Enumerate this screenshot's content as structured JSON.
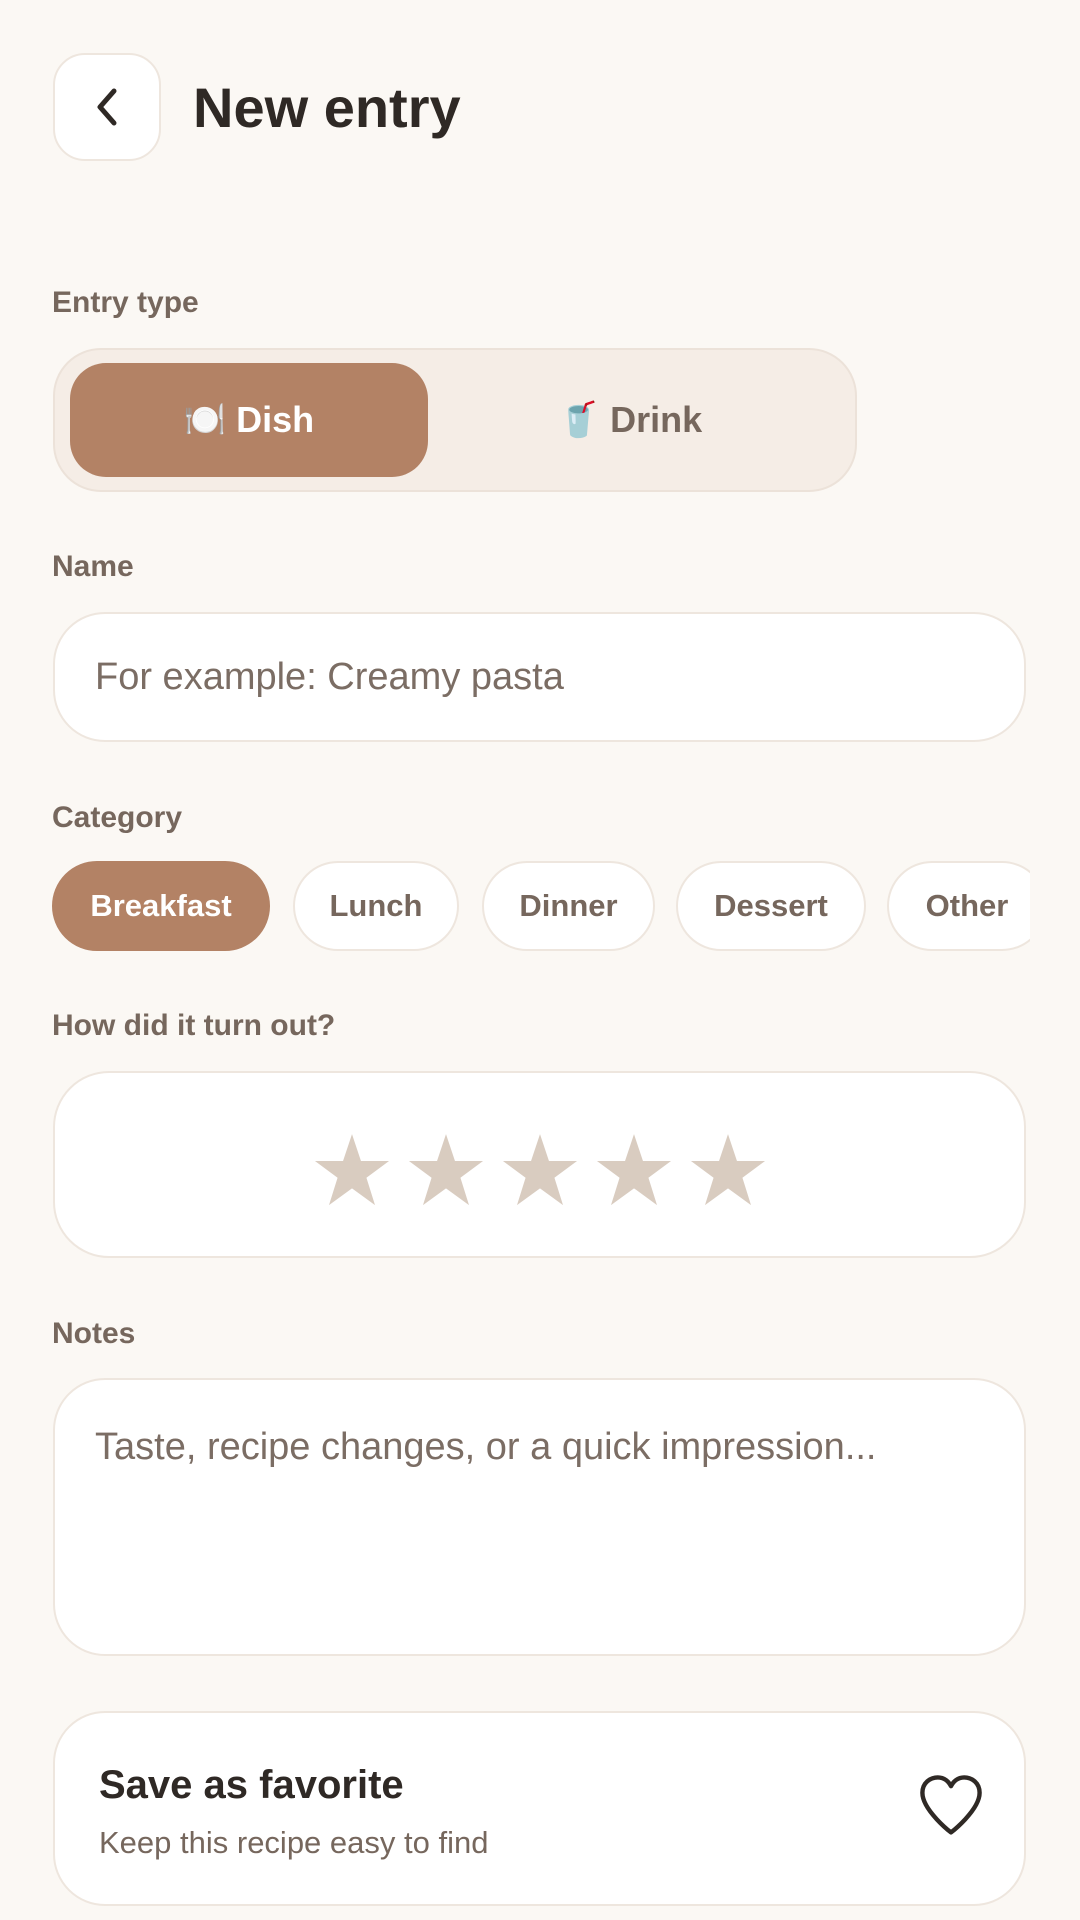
{
  "header": {
    "title": "New entry"
  },
  "entry_type": {
    "label": "Entry type",
    "options": [
      {
        "emoji": "🍽️",
        "label": "Dish",
        "selected": true
      },
      {
        "emoji": "🥤",
        "label": "Drink",
        "selected": false
      }
    ]
  },
  "name": {
    "label": "Name",
    "value": "",
    "placeholder": "For example: Creamy pasta"
  },
  "category": {
    "label": "Category",
    "options": [
      "Breakfast",
      "Lunch",
      "Dinner",
      "Dessert",
      "Other"
    ],
    "selected": "Breakfast"
  },
  "rating": {
    "label": "How did it turn out?",
    "value": 0,
    "max": 5
  },
  "notes": {
    "label": "Notes",
    "value": "",
    "placeholder": "Taste, recipe changes, or a quick impression..."
  },
  "favorite": {
    "title": "Save as favorite",
    "subtitle": "Keep this recipe easy to find",
    "active": false
  },
  "colors": {
    "accent": "#b38265",
    "background": "#fbf8f4",
    "star_inactive": "#d9ccc0"
  }
}
